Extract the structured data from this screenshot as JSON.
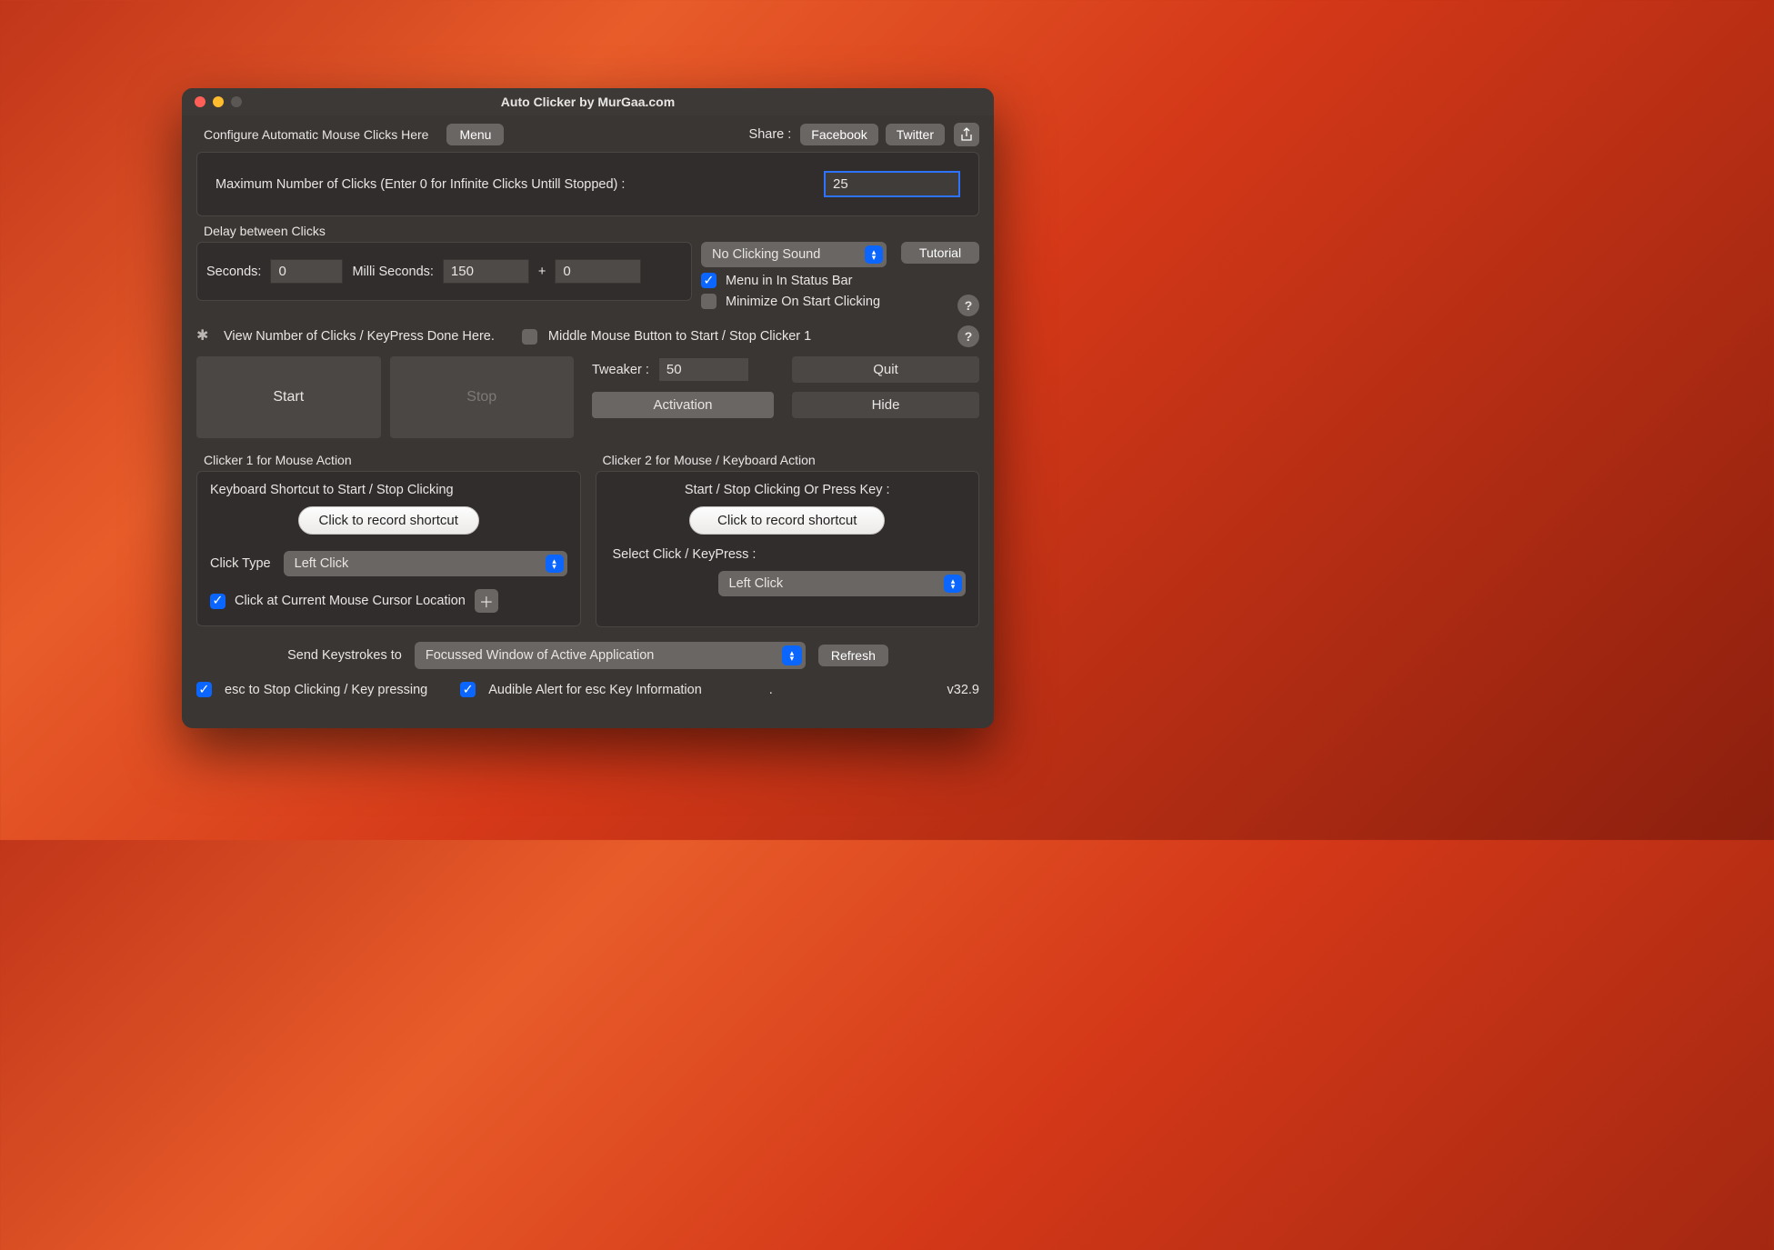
{
  "window": {
    "title": "Auto Clicker by MurGaa.com"
  },
  "top": {
    "configure_label": "Configure Automatic Mouse Clicks Here",
    "menu_btn": "Menu",
    "share_label": "Share :",
    "facebook_btn": "Facebook",
    "twitter_btn": "Twitter"
  },
  "max_clicks": {
    "label": "Maximum Number of Clicks (Enter 0 for Infinite Clicks Untill Stopped) :",
    "value": "25"
  },
  "delay": {
    "section_label": "Delay between Clicks",
    "seconds_label": "Seconds:",
    "seconds_value": "0",
    "milli_label": "Milli Seconds:",
    "milli_value": "150",
    "plus": "+",
    "extra_value": "0"
  },
  "sound": {
    "selected": "No Clicking Sound"
  },
  "tutorial_btn": "Tutorial",
  "menu_status_label": "Menu in In Status Bar",
  "minimize_label": "Minimize On Start Clicking",
  "view_clicks_label": "View Number of Clicks / KeyPress Done Here.",
  "middle_mouse_label": "Middle Mouse Button to Start / Stop Clicker 1",
  "start_btn": "Start",
  "stop_btn": "Stop",
  "tweaker_label": "Tweaker :",
  "tweaker_value": "50",
  "activation_btn": "Activation",
  "quit_btn": "Quit",
  "hide_btn": "Hide",
  "clicker1": {
    "title": "Clicker 1 for Mouse Action",
    "shortcut_label": "Keyboard Shortcut to Start / Stop Clicking",
    "record_btn": "Click to record shortcut",
    "click_type_label": "Click Type",
    "click_type_value": "Left Click",
    "cursor_loc_label": "Click at Current Mouse Cursor Location"
  },
  "clicker2": {
    "title": "Clicker 2 for Mouse / Keyboard Action",
    "shortcut_label": "Start / Stop Clicking Or Press Key :",
    "record_btn": "Click to record shortcut",
    "select_label": "Select Click / KeyPress :",
    "select_value": "Left Click"
  },
  "keystrokes": {
    "label": "Send Keystrokes to",
    "value": "Focussed Window of Active Application",
    "refresh_btn": "Refresh"
  },
  "esc_label": "esc to Stop Clicking / Key pressing",
  "audible_label": "Audible Alert for esc Key Information",
  "dot": ".",
  "version": "v32.9"
}
